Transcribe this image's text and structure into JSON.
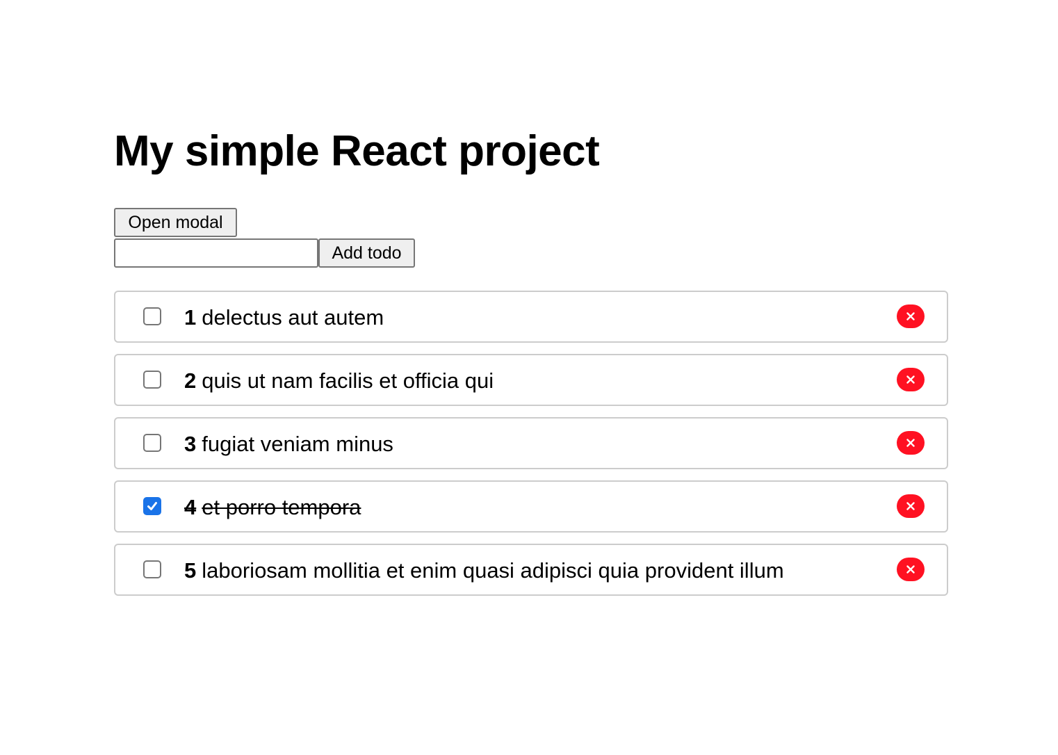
{
  "page": {
    "title": "My simple React project"
  },
  "controls": {
    "open_modal_label": "Open modal",
    "add_todo_label": "Add todo",
    "todo_input_value": "",
    "todo_input_placeholder": ""
  },
  "todos": [
    {
      "id": "1",
      "title": "delectus aut autem",
      "completed": false
    },
    {
      "id": "2",
      "title": "quis ut nam facilis et officia qui",
      "completed": false
    },
    {
      "id": "3",
      "title": "fugiat veniam minus",
      "completed": false
    },
    {
      "id": "4",
      "title": "et porro tempora",
      "completed": true
    },
    {
      "id": "5",
      "title": "laboriosam mollitia et enim quasi adipisci quia provident illum",
      "completed": false
    }
  ],
  "icons": {
    "delete": "close-icon",
    "check": "checkmark-icon"
  },
  "colors": {
    "delete_button": "#ff1122",
    "checkbox_checked": "#1a73e8",
    "item_border": "#cccccc"
  }
}
